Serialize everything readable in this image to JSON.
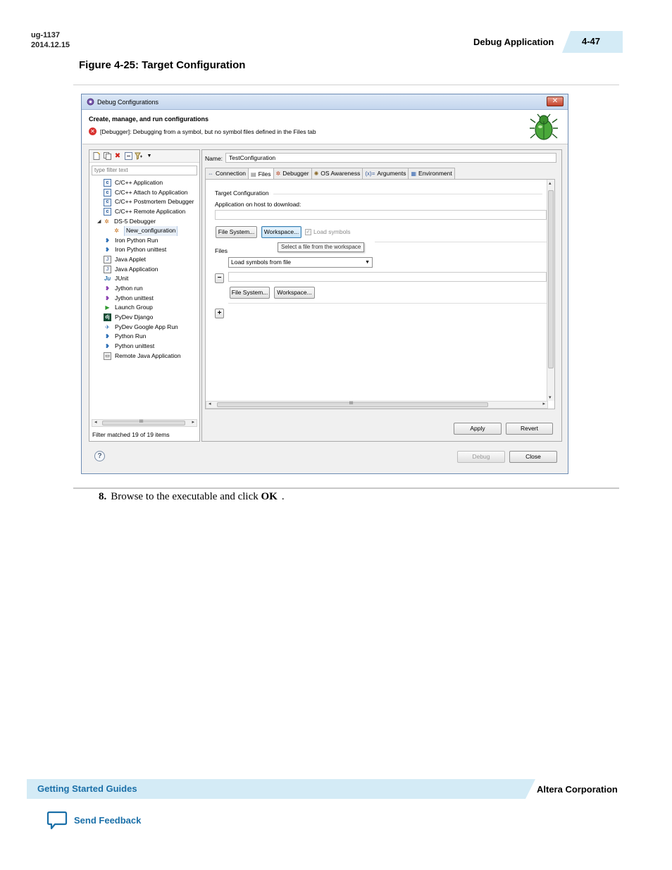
{
  "page_header": {
    "doc_id": "ug-1137",
    "date": "2014.12.15",
    "section": "Debug Application",
    "page_number": "4-47"
  },
  "figure_title": "Figure 4-25: Target Configuration",
  "dialog": {
    "title": "Debug Configurations",
    "banner_title": "Create, manage, and run configurations",
    "banner_error": "[Debugger]: Debugging from a symbol, but no symbol files defined in the Files tab",
    "filter_placeholder": "type filter text",
    "tree": [
      {
        "label": "C/C++ Application",
        "icon": "c-icon"
      },
      {
        "label": "C/C++ Attach to Application",
        "icon": "c-icon"
      },
      {
        "label": "C/C++ Postmortem Debugger",
        "icon": "c-icon"
      },
      {
        "label": "C/C++ Remote Application",
        "icon": "c-icon"
      },
      {
        "label": "DS-5 Debugger",
        "icon": "gear-icon"
      },
      {
        "label": "New_configuration",
        "icon": "gear-icon"
      },
      {
        "label": "Iron Python Run",
        "icon": "python-icon"
      },
      {
        "label": "Iron Python unittest",
        "icon": "python-icon"
      },
      {
        "label": "Java Applet",
        "icon": "java-icon"
      },
      {
        "label": "Java Application",
        "icon": "java-icon"
      },
      {
        "label": "JUnit",
        "icon": "junit-icon"
      },
      {
        "label": "Jython run",
        "icon": "jython-icon"
      },
      {
        "label": "Jython unittest",
        "icon": "jython-icon"
      },
      {
        "label": "Launch Group",
        "icon": "launch-icon"
      },
      {
        "label": "PyDev Django",
        "icon": "django-icon"
      },
      {
        "label": "PyDev Google App Run",
        "icon": "gae-icon"
      },
      {
        "label": "Python Run",
        "icon": "python-icon"
      },
      {
        "label": "Python unittest",
        "icon": "python-icon"
      },
      {
        "label": "Remote Java Application",
        "icon": "remote-icon"
      }
    ],
    "filter_status": "Filter matched 19 of 19 items",
    "name_label": "Name:",
    "name_value": "TestConfiguration",
    "tabs": [
      {
        "label": "Connection",
        "icon": "connection-icon"
      },
      {
        "label": "Files",
        "icon": "files-icon"
      },
      {
        "label": "Debugger",
        "icon": "debugger-icon"
      },
      {
        "label": "OS Awareness",
        "icon": "os-icon"
      },
      {
        "label": "Arguments",
        "icon": "arguments-icon"
      },
      {
        "label": "Environment",
        "icon": "environment-icon"
      }
    ],
    "target_configuration_label": "Target Configuration",
    "app_on_host_label": "Application on host to download:",
    "file_system_button": "File System...",
    "workspace_button": "Workspace...",
    "load_symbols_label": "Load symbols",
    "tooltip": "Select a file from the workspace",
    "files_label": "Files",
    "files_select_value": "Load symbols from file",
    "files_file_system_button": "File System...",
    "files_workspace_button": "Workspace...",
    "minus_button": "−",
    "plus_button": "+",
    "hscroll_grip": "III",
    "apply_button": "Apply",
    "revert_button": "Revert",
    "debug_button": "Debug",
    "close_button": "Close"
  },
  "step": {
    "number": "8.",
    "text_before": "Browse to the executable and click ",
    "bold": "OK",
    "text_after": "."
  },
  "footer": {
    "left": "Getting Started Guides",
    "right": "Altera Corporation",
    "feedback": "Send Feedback"
  },
  "colors": {
    "accent_blue": "#1a6fa8",
    "band_blue": "#d4ebf6",
    "error_red": "#d8322f"
  }
}
